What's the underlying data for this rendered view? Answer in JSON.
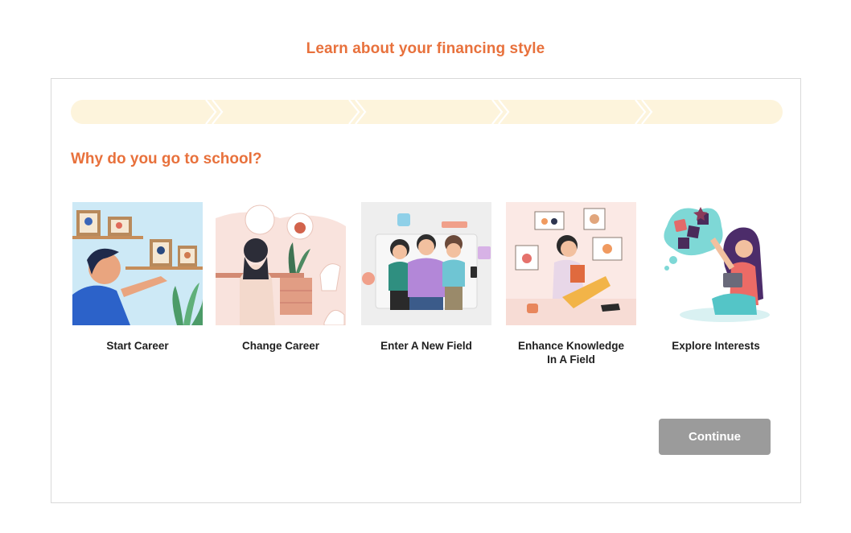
{
  "header": {
    "title": "Learn about your financing style"
  },
  "progress": {
    "steps_total": 5,
    "steps_done": 0,
    "track_color": "#fdf4dc",
    "chevron_color": "#ffffff"
  },
  "question": {
    "text": "Why do you go to school?"
  },
  "options": [
    {
      "label": "Start Career",
      "icon": "start-career-illustration"
    },
    {
      "label": "Change Career",
      "icon": "change-career-illustration"
    },
    {
      "label": "Enter A New Field",
      "icon": "new-field-illustration"
    },
    {
      "label": "Enhance Knowledge\nIn A Field",
      "icon": "enhance-knowledge-illustration"
    },
    {
      "label": "Explore Interests",
      "icon": "explore-interests-illustration"
    }
  ],
  "actions": {
    "continue_label": "Continue",
    "continue_enabled": false
  },
  "colors": {
    "accent": "#e8713c",
    "button_disabled": "#9b9b9b",
    "border": "#d9d9d9"
  }
}
